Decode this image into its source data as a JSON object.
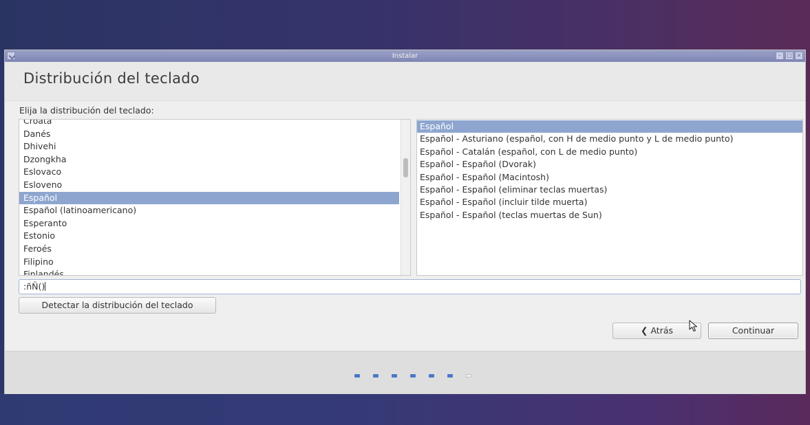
{
  "window": {
    "title": "Instalar"
  },
  "header": {
    "title": "Distribución del teclado"
  },
  "prompt": "Elija la distribución del teclado:",
  "layouts": [
    "Croata",
    "Danés",
    "Dhivehi",
    "Dzongkha",
    "Eslovaco",
    "Esloveno",
    "Español",
    "Español (latinoamericano)",
    "Esperanto",
    "Estonio",
    "Feroés",
    "Filipino",
    "Finlandés"
  ],
  "layouts_selected": "Español",
  "variants": [
    "Español",
    "Español - Asturiano (español, con H de medio punto y L de medio punto)",
    "Español - Catalán (español, con L de medio punto)",
    "Español - Español (Dvorak)",
    "Español - Español (Macintosh)",
    "Español - Español (eliminar teclas muertas)",
    "Español - Español (incluir tilde muerta)",
    "Español - Español (teclas muertas de Sun)"
  ],
  "variants_selected": "Español",
  "test_input": {
    "value": ":ñÑ()"
  },
  "buttons": {
    "detect": "Detectar la distribución del teclado",
    "back": "Atrás",
    "continue": "Continuar"
  },
  "progress": {
    "total_steps": 7,
    "completed_steps": 6
  }
}
